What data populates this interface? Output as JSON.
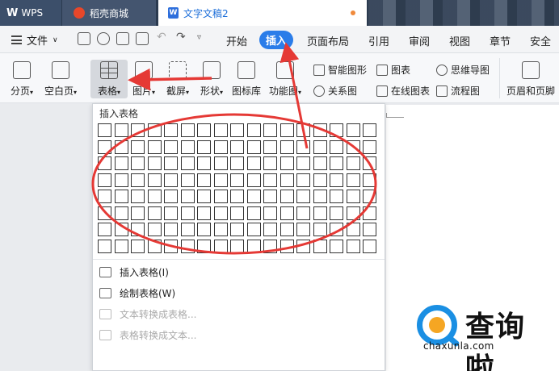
{
  "tabs": {
    "wps": "WPS",
    "shop": "稻壳商城",
    "doc": "文字文稿2"
  },
  "menubar": {
    "file": "文件",
    "items": [
      "开始",
      "插入",
      "页面布局",
      "引用",
      "审阅",
      "视图",
      "章节",
      "安全"
    ],
    "active": "插入"
  },
  "ribbon": {
    "fenye": "分页",
    "kongbaiye": "空白页",
    "table": "表格",
    "picture": "图片",
    "screenshot": "截屏",
    "shape": "形状",
    "iconlib": "图标库",
    "func": "功能图",
    "smartart": "智能图形",
    "chart": "图表",
    "mindmap": "思维导图",
    "relation": "关系图",
    "onlinechart": "在线图表",
    "flowchart": "流程图",
    "header": "页眉和页脚"
  },
  "dropdown": {
    "title": "插入表格",
    "insert": "插入表格(I)",
    "draw": "绘制表格(W)",
    "text_to_table": "文本转换成表格...",
    "table_to_text": "表格转换成文本..."
  },
  "watermark": {
    "text": "查询啦",
    "url": "chaxunla.com"
  },
  "colors": {
    "accent": "#2b7de9",
    "annotation": "#e53935",
    "titlebar": "#2b3a4f"
  }
}
